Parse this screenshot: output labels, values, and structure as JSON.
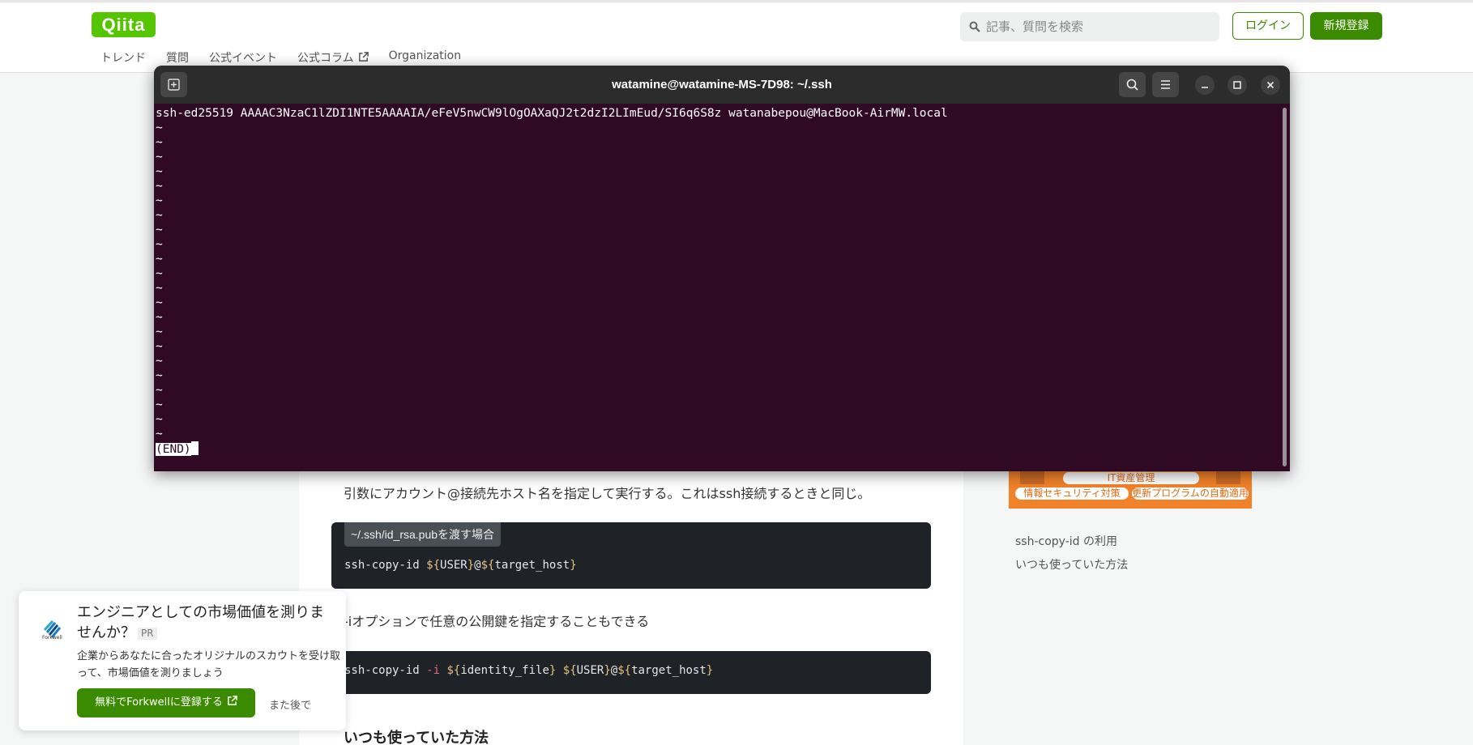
{
  "header": {
    "logo": "Qiita",
    "nav": [
      "トレンド",
      "質問",
      "公式イベント",
      "公式コラム",
      "Organization"
    ],
    "search_placeholder": "記事、質問を検索",
    "login_label": "ログイン",
    "signup_label": "新規登録"
  },
  "terminal": {
    "title": "watamine@watamine-MS-7D98: ~/.ssh",
    "first_line": "ssh-ed25519 AAAAC3NzaC1lZDI1NTE5AAAAIA/eFeV5nwCW9lOgOAXaQJ2t2dzI2LImEud/SI6q6S8z watanabepou@MacBook-AirMW.local",
    "tilde": "~",
    "end_marker": "(END)"
  },
  "article": {
    "para1": "引数にアカウント@接続先ホスト名を指定して実行する。これはssh接続するときと同じ。",
    "code1_title": "~/.ssh/id_rsa.pubを渡す場合",
    "code1": {
      "cmd": "ssh-copy-id ",
      "d1": "${",
      "v1": "USER",
      "c1": "}",
      "at": "@",
      "d2": "${",
      "v2": "target_host",
      "c2": "}"
    },
    "para2": "-iオプションで任意の公開鍵を指定することもできる",
    "code2": {
      "cmd": "ssh-copy-id ",
      "opt": "-i",
      "sp": " ",
      "d1": "${",
      "v1": "identity_file",
      "c1": "}",
      "sp2": " ",
      "d2": "${",
      "v2": "USER",
      "c2": "}",
      "at": "@",
      "d3": "${",
      "v3": "target_host",
      "c3": "}"
    },
    "heading": "いつも使っていた方法"
  },
  "sidebar": {
    "ad_pill1": "IT資産管理",
    "ad_pill2": "情報セキュリティ対策",
    "ad_pill3": "更新プログラムの自動適用",
    "toc": [
      "ssh-copy-id の利用",
      "いつも使っていた方法"
    ]
  },
  "forkwell": {
    "logo_text": "Forkwell",
    "title": "エンジニアとしての市場価値を測りませんか？",
    "pr": "PR",
    "body": "企業からあなたに合ったオリジナルのスカウトを受け取って、市場価値を測りましょう",
    "cta": "無料でForkwellに登録する",
    "later": "また後で"
  },
  "colors": {
    "qiita_green": "#55c500",
    "button_green": "#3b8b00",
    "terminal_bg": "#300a24",
    "ad_orange": "#f2822a"
  }
}
